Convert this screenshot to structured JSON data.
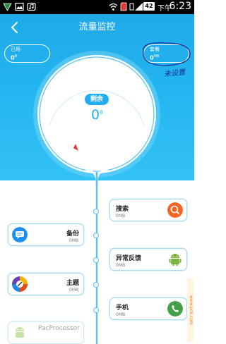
{
  "status_bar": {
    "battery": "42",
    "ampm": "下午",
    "time": "6:23",
    "icons": [
      "vpn-shield-icon",
      "gallery-icon",
      "music-icon",
      "wifi-icon",
      "sd-card-icon",
      "vibrate-icon",
      "signal-icon"
    ]
  },
  "header": {
    "title": "流量监控",
    "back_icon": "back-arrow-icon"
  },
  "used": {
    "label": "已用",
    "value": "0",
    "unit": "B"
  },
  "package": {
    "label": "套餐",
    "value": "0",
    "unit": "MB"
  },
  "annotation": "未设置",
  "dial": {
    "remain_label": "剩余",
    "remain_value": "0",
    "remain_unit": "B"
  },
  "timeline": {
    "cards": [
      {
        "title": "搜索",
        "sub": "0MB",
        "side": "right",
        "icon": "search-icon",
        "color": "#f26522"
      },
      {
        "title": "备份",
        "sub": "0MB",
        "side": "left",
        "icon": "chat-bubble-icon",
        "color": "#1c8ff0"
      },
      {
        "title": "异常反馈",
        "sub": "0MB",
        "side": "right",
        "icon": "android-icon",
        "color": "#7cb342"
      },
      {
        "title": "主题",
        "sub": "0MB",
        "side": "left",
        "icon": "theme-brush-icon",
        "color": "#8e44ad"
      },
      {
        "title": "手机",
        "sub": "0MB",
        "side": "right",
        "icon": "phone-icon",
        "color": "#43a047"
      },
      {
        "title": "PacProcessor",
        "sub": "",
        "side": "left",
        "icon": "android-icon",
        "color": "#9ccc65"
      }
    ]
  },
  "watermark": "www.pc6.com"
}
